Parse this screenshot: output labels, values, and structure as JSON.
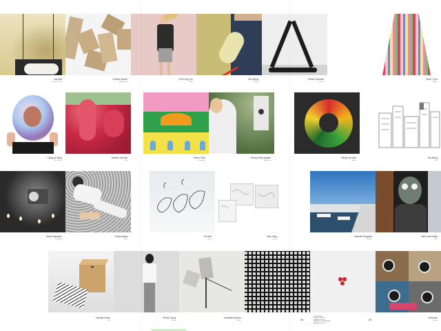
{
  "colors": {
    "page_background": "#ffffff",
    "caption_text": "#333333",
    "accent_red": "#c8282d",
    "sky_blue": "#3f88c9"
  },
  "captions": {
    "row1": [
      {
        "name": "Asa Bell",
        "sub": "Stone in Coats"
      },
      {
        "name": "Cristina Gaucci",
        "sub": "Model Stack"
      },
      {
        "name": "Chih-Ying Lee",
        "sub": "Body"
      },
      {
        "name": "Erik Wong",
        "sub": "Pulling"
      },
      {
        "name": "Esther Domenie",
        "sub": "Contact"
      },
      {
        "name": "Sean Y Zoe",
        "sub": "Ruffles"
      }
    ],
    "row2": [
      {
        "name": "Ching-an Jiang",
        "sub": "Glass Body"
      },
      {
        "name": "Doreen Ozil Hilo",
        "sub": "Pulp"
      },
      {
        "name": "Helen Chan",
        "sub": "Landscape"
      },
      {
        "name": "Emmy Fiona Dayrite",
        "sub": "Birdhouse"
      },
      {
        "name": "Meng Yun Hwe",
        "sub": "Ribbon"
      },
      {
        "name": "Kai Wong",
        "sub": "City"
      }
    ],
    "row3": [
      {
        "name": "Seunk Hyunjeon",
        "sub": "Moonlight"
      },
      {
        "name": "Ching Huang",
        "sub": "Gravel"
      },
      {
        "name": "Ha Suni",
        "sub": "Drops"
      },
      {
        "name": "Sam Yang",
        "sub": "Sketch"
      },
      {
        "name": "Hannah Shepperd",
        "sub": "Harbour"
      },
      {
        "name": "Vitor Leal Freitas",
        "sub": "Mask"
      }
    ],
    "row4": [
      {
        "name": "Hannah Green",
        "sub": "Box"
      },
      {
        "name": "Penny Young",
        "sub": "Portrait"
      },
      {
        "name": "Annabelle Ruxton",
        "sub": "Kinetic"
      },
      {
        "name": "",
        "sub": ""
      },
      {
        "name": "",
        "sub": ""
      },
      {
        "name": "Al Boolse",
        "sub": "Collage"
      }
    ]
  },
  "page_numbers": [
    "58",
    "59"
  ],
  "colophon": "Designed by\nDesign Collective\nPrinted in the UK\nISBN 000-0-00-000000-0\nAll rights reserved"
}
